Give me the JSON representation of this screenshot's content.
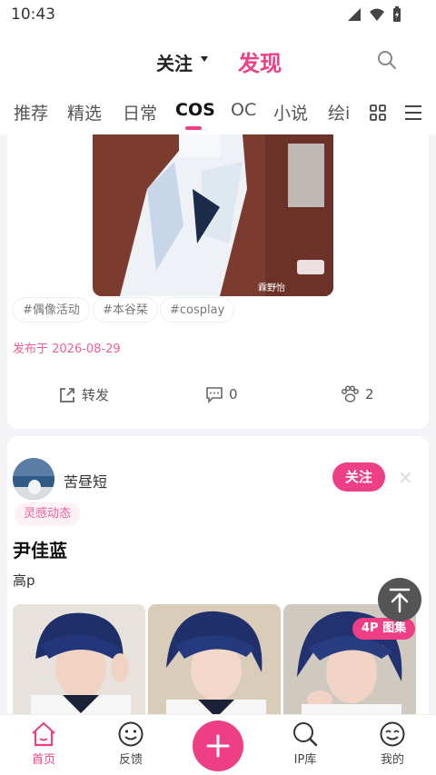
{
  "status_bar": {
    "time": "10:43"
  },
  "top_nav": {
    "follow_label": "关注",
    "discover_label": "发现"
  },
  "tabs": [
    {
      "label": "推荐"
    },
    {
      "label": "精选"
    },
    {
      "label": "日常"
    },
    {
      "label": "COS"
    },
    {
      "label": "OC"
    },
    {
      "label": "小说"
    },
    {
      "label": "绘i"
    }
  ],
  "card1": {
    "watermark": "霖野怡桑-1069491",
    "tags": [
      "#偶像活动",
      "#本谷栞",
      "#cosplay"
    ],
    "published": "发布于 2026-08-29",
    "share_label": "转发",
    "comment_count": "0",
    "like_count": "2"
  },
  "card2": {
    "author": "苦昼短",
    "follow_label": "关注",
    "badge": "灵感动态",
    "title": "尹佳蓝",
    "text": "高p",
    "image_set_badge": "4P 图集"
  },
  "bottom_nav": {
    "home": "首页",
    "feedback": "反馈",
    "ip_library": "IP库",
    "mine": "我的"
  },
  "colors": {
    "accent": "#ee3f86"
  }
}
